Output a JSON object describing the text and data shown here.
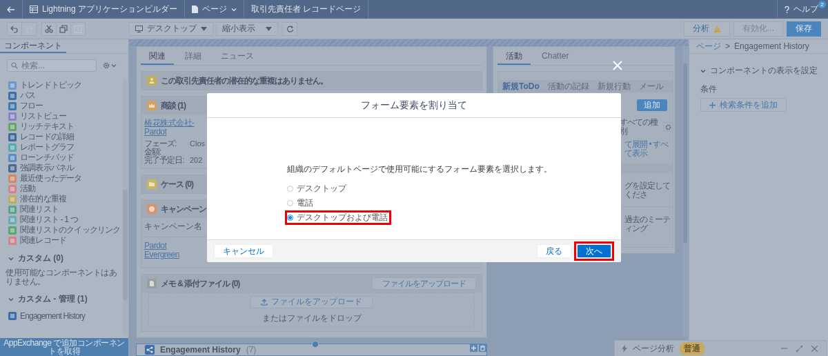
{
  "top_bar": {
    "app_title": "Lightning アプリケーションビルダー",
    "page_menu": "ページ",
    "record_page": "取引先責任者 レコードページ",
    "help": "ヘルプ",
    "help_badge": "2"
  },
  "toolbar": {
    "edit_buttons": [
      {
        "kind": "undo",
        "disabled": false
      },
      {
        "kind": "redo",
        "disabled": true
      },
      {
        "kind": "cut",
        "disabled": false
      },
      {
        "kind": "copy",
        "disabled": false
      },
      {
        "kind": "paste",
        "disabled": true
      }
    ],
    "device": "デスクトップ",
    "zoom": "縮小表示",
    "analyze": "分析",
    "activate": {
      "label": "有効化...",
      "disabled": true
    },
    "save": "保存"
  },
  "sidebar": {
    "tabs": [
      {
        "label": "コンポーネント",
        "selected": true
      }
    ],
    "search": {
      "placeholder": "検索..."
    },
    "items": [
      {
        "label": "トレンドトピック",
        "color": "#6b97c9"
      },
      {
        "label": "パス",
        "color": "#3f6ea6"
      },
      {
        "label": "フロー",
        "color": "#3f7aab"
      },
      {
        "label": "リストビュー",
        "color": "#8a84c4"
      },
      {
        "label": "リッチテキスト",
        "color": "#66a467"
      },
      {
        "label": "レコードの詳細",
        "color": "#3e6b99"
      },
      {
        "label": "レポートグラフ",
        "color": "#5aa9aa"
      },
      {
        "label": "ローンチパッド",
        "color": "#5d8cc2"
      },
      {
        "label": "強調表示パネル",
        "color": "#4a6a8c"
      },
      {
        "label": "最近使ったデータ",
        "color": "#d3895e"
      },
      {
        "label": "活動",
        "color": "#d3838c"
      },
      {
        "label": "潜在的な重複",
        "color": "#c4ad5a"
      },
      {
        "label": "関連リスト",
        "color": "#59a38a"
      },
      {
        "label": "関連リスト - 1 つ",
        "color": "#68adad"
      },
      {
        "label": "関連リストのクイックリンク",
        "color": "#5ca56c"
      },
      {
        "label": "関連レコード",
        "color": "#d3838c"
      }
    ],
    "sections": [
      {
        "title": "カスタム (0)",
        "expanded": true,
        "empty": "使用可能なコンポーネントはありません。"
      },
      {
        "title": "カスタム - 管理 (1)",
        "expanded": true,
        "items": [
          {
            "label": "Engagement History",
            "color": "#3f6ea6"
          }
        ]
      }
    ],
    "appexchange": "AppExchange で追加コンポーネントを取得"
  },
  "canvas": {
    "main_tabs": [
      {
        "label": "関連",
        "selected": true
      },
      {
        "label": "詳細",
        "selected": false
      },
      {
        "label": "ニュース",
        "selected": false
      }
    ],
    "duplicates_notice": "この取引先責任者の潜在的な重複はありません。",
    "opportunities": {
      "title": "商談 (1)",
      "record": "椿花株式会社-Pardot",
      "fields": [
        {
          "label": "フェーズ:",
          "value": "Clos"
        },
        {
          "label": "金額:"
        },
        {
          "label": "完了予定日:",
          "value": "202"
        }
      ]
    },
    "cases": {
      "title": "ケース (0)"
    },
    "campaigns": {
      "title": "キャンペーン",
      "column": "キャンペーン名",
      "record": "Pardot Evergreen"
    },
    "notes": {
      "title": "メモ & 添付ファイル (0)",
      "upload_button": "ファイルをアップロード",
      "drop_button": "ファイルをアップロード",
      "drop_hint": "またはファイルをドロップ"
    },
    "activity": {
      "tabs": [
        {
          "label": "活動",
          "selected": true
        },
        {
          "label": "Chatter",
          "selected": false
        }
      ],
      "subtabs": [
        {
          "label": "新規ToDo",
          "selected": true
        },
        {
          "label": "活動の記録",
          "selected": false
        },
        {
          "label": "新規行動",
          "selected": false
        },
        {
          "label": "メール",
          "selected": false
        }
      ],
      "add_button": "追加",
      "filter": "すべての種別",
      "links": "て展開 • すべて表示",
      "upcoming_hint": "グを設定してくださ",
      "past_hint": "過去のミーティング"
    },
    "selected_component": {
      "title": "Engagement History",
      "count": "(7)"
    }
  },
  "properties": {
    "breadcrumb": [
      {
        "label": "ページ",
        "kind": "link"
      },
      {
        "label": "Engagement History",
        "kind": "current"
      }
    ],
    "separator": ">",
    "section": {
      "title": "コンポーネントの表示を設定",
      "expanded": true
    },
    "conditions_label": "条件",
    "add_filter": "検索条件を追加"
  },
  "modal": {
    "title": "フォーム要素を割り当て",
    "prompt": "組織のデフォルトページで使用可能にするフォーム要素を選択します。",
    "options": [
      {
        "label": "デスクトップ",
        "selected": false,
        "highlighted": false
      },
      {
        "label": "電話",
        "selected": false,
        "highlighted": false
      },
      {
        "label": "デスクトップおよび電話",
        "selected": true,
        "highlighted": true
      }
    ],
    "buttons": [
      {
        "label": "キャンセル",
        "kind": "neutral",
        "highlighted": false
      },
      {
        "label": "戻る",
        "kind": "neutral",
        "highlighted": false
      },
      {
        "label": "次へ",
        "kind": "brand",
        "highlighted": true
      }
    ]
  },
  "page_analysis": {
    "label": "ページ分析",
    "status": {
      "label": "普通",
      "color": "#c9a860"
    }
  }
}
